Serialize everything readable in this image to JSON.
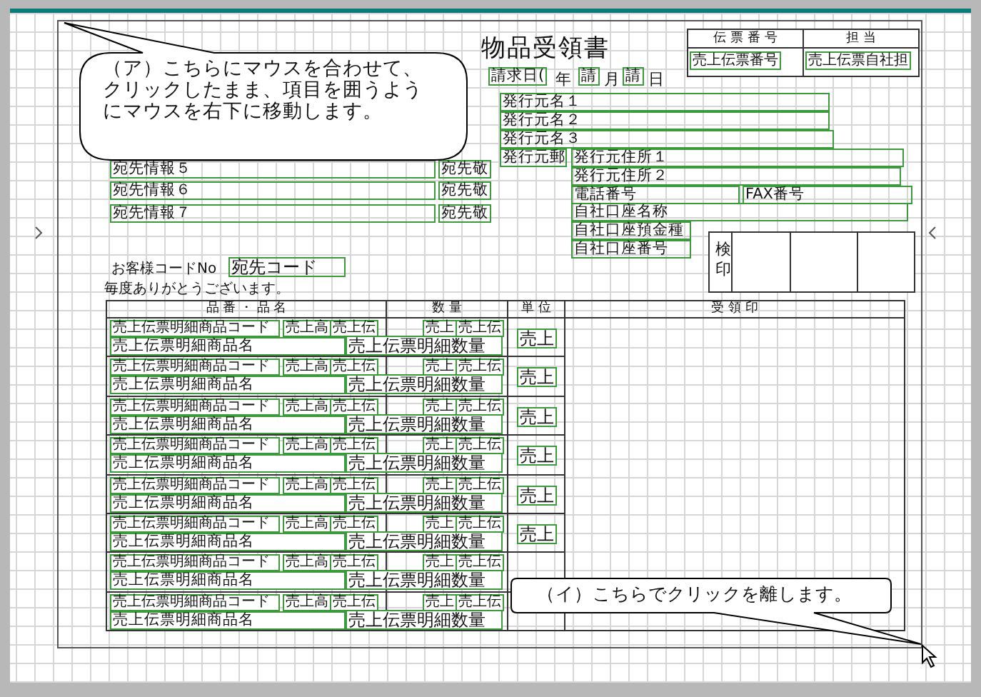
{
  "title": "物品受領書",
  "slip_table": {
    "headers": [
      "伝 票 番 号",
      "担 当"
    ],
    "fields": [
      "売上伝票番号",
      "売上伝票自社担"
    ]
  },
  "date_line": [
    {
      "field": "請求日(",
      "label": "年"
    },
    {
      "field": "請",
      "label": "月"
    },
    {
      "field": "請",
      "label": "日"
    }
  ],
  "issuer_fields": [
    "発行元名１",
    "発行元名２",
    "発行元名３",
    "発行元郵",
    "発行元住所１",
    "発行元住所２",
    "電話番号",
    "FAX番号",
    "自社口座名称",
    "自社口座預金種",
    "自社口座番号"
  ],
  "recipient_fields": [
    {
      "info": "宛先情報５",
      "honorific": "宛先敬"
    },
    {
      "info": "宛先情報６",
      "honorific": "宛先敬"
    },
    {
      "info": "宛先情報７",
      "honorific": "宛先敬"
    }
  ],
  "customer_code": {
    "label": "お客様コードNo",
    "field": "宛先コード"
  },
  "greeting": "毎度ありがとうございます。",
  "stamp_box": {
    "label": "検印"
  },
  "table": {
    "columns": [
      "品 番 ・ 品 名",
      "数 量",
      "単 位",
      "受 領 印"
    ],
    "rows": [
      {
        "code": "売上伝票明細商品コード",
        "sub_1": "売上高",
        "sub_2": "売上伝",
        "qty_sub_1": "売上",
        "qty_sub_2": "売上伝",
        "name": "売上伝票明細商品名",
        "qty": "売上伝票明細数量",
        "unit": "売上"
      },
      {
        "code": "売上伝票明細商品コード",
        "sub_1": "売上高",
        "sub_2": "売上伝",
        "qty_sub_1": "売上",
        "qty_sub_2": "売上伝",
        "name": "売上伝票明細商品名",
        "qty": "売上伝票明細数量",
        "unit": "売上"
      },
      {
        "code": "売上伝票明細商品コード",
        "sub_1": "売上高",
        "sub_2": "売上伝",
        "qty_sub_1": "売上",
        "qty_sub_2": "売上伝",
        "name": "売上伝票明細商品名",
        "qty": "売上伝票明細数量",
        "unit": "売上"
      },
      {
        "code": "売上伝票明細商品コード",
        "sub_1": "売上高",
        "sub_2": "売上伝",
        "qty_sub_1": "売上",
        "qty_sub_2": "売上伝",
        "name": "売上伝票明細商品名",
        "qty": "売上伝票明細数量",
        "unit": "売上"
      },
      {
        "code": "売上伝票明細商品コード",
        "sub_1": "売上高",
        "sub_2": "売上伝",
        "qty_sub_1": "売上",
        "qty_sub_2": "売上伝",
        "name": "売上伝票明細商品名",
        "qty": "売上伝票明細数量",
        "unit": "売上"
      },
      {
        "code": "売上伝票明細商品コード",
        "sub_1": "売上高",
        "sub_2": "売上伝",
        "qty_sub_1": "売上",
        "qty_sub_2": "売上伝",
        "name": "売上伝票明細商品名",
        "qty": "売上伝票明細数量",
        "unit": "売上"
      },
      {
        "code": "売上伝票明細商品コード",
        "sub_1": "売上高",
        "sub_2": "売上伝",
        "qty_sub_1": "売上",
        "qty_sub_2": "売上伝",
        "name": "売上伝票明細商品名",
        "qty": "売上伝票明細数量"
      },
      {
        "code": "売上伝票明細商品コード",
        "sub_1": "売上高",
        "sub_2": "売上伝",
        "qty_sub_1": "売上",
        "qty_sub_2": "売上伝",
        "name": "売上伝票明細商品名",
        "qty": "売上伝票明細数量"
      }
    ]
  },
  "callouts": [
    {
      "lines": [
        "（ア）こちらにマウスを合わせて、",
        "クリックしたまま、項目を囲うよう",
        "にマウスを右下に移動します。"
      ]
    },
    {
      "lines": [
        "（イ）こちらでクリックを離します。"
      ]
    }
  ]
}
